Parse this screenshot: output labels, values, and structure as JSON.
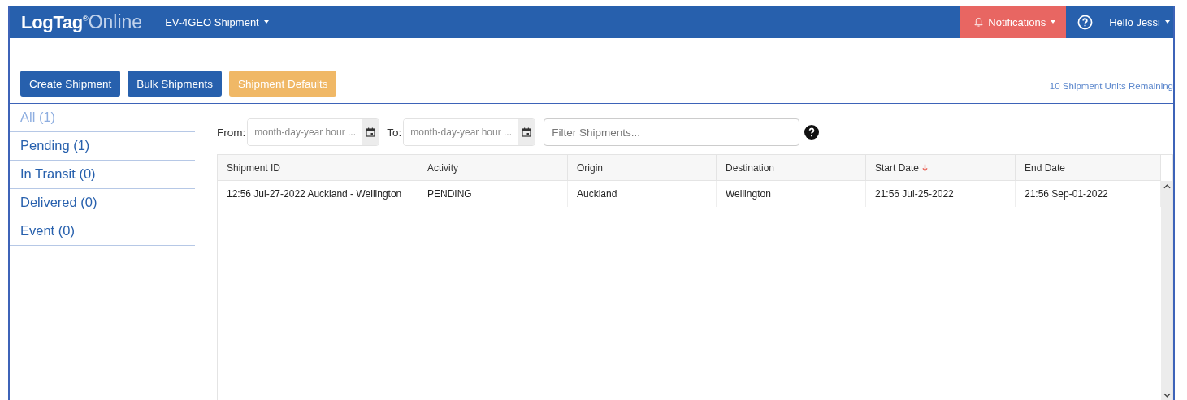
{
  "brand": {
    "name": "LogTag",
    "mark": "®",
    "suffix": "Online"
  },
  "nav": {
    "shipment_menu": "EV-4GEO Shipment",
    "notifications": "Notifications",
    "user": "Hello Jessi"
  },
  "actions": [
    {
      "label": "Create Shipment",
      "kind": "primary"
    },
    {
      "label": "Bulk Shipments",
      "kind": "primary"
    },
    {
      "label": "Shipment Defaults",
      "kind": "warning"
    }
  ],
  "units_remaining": "10 Shipment Units Remaining",
  "sidebar": {
    "items": [
      {
        "label": "All (1)",
        "selected": true
      },
      {
        "label": "Pending (1)",
        "selected": false
      },
      {
        "label": "In Transit (0)",
        "selected": false
      },
      {
        "label": "Delivered (0)",
        "selected": false
      },
      {
        "label": "Event (0)",
        "selected": false
      }
    ]
  },
  "filters": {
    "from_label": "From:",
    "from_placeholder": "month-day-year hour ...",
    "to_label": "To:",
    "to_placeholder": "month-day-year hour ...",
    "search_placeholder": "Filter Shipments..."
  },
  "table": {
    "columns": [
      {
        "label": "Shipment ID",
        "sorted": false
      },
      {
        "label": "Activity",
        "sorted": false
      },
      {
        "label": "Origin",
        "sorted": false
      },
      {
        "label": "Destination",
        "sorted": false
      },
      {
        "label": "Start Date",
        "sorted": true
      },
      {
        "label": "End Date",
        "sorted": false
      }
    ],
    "rows": [
      [
        "12:56 Jul-27-2022 Auckland - Wellington",
        "PENDING",
        "Auckland",
        "Wellington",
        "21:56 Jul-25-2022",
        "21:56 Sep-01-2022"
      ]
    ]
  }
}
